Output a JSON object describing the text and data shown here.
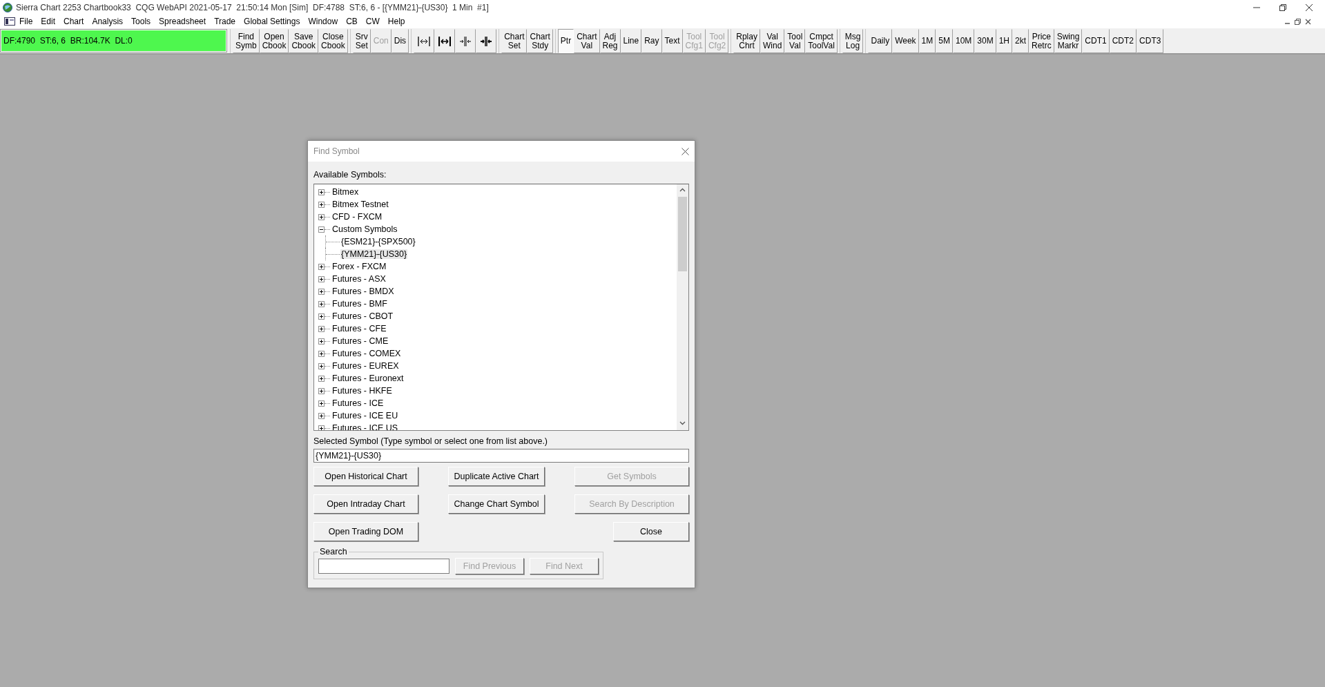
{
  "window": {
    "title": "Sierra Chart 2253 Chartbook33  CQG WebAPI 2021-05-17  21:50:14 Mon [Sim]  DF:4788  ST:6, 6 - [{YMM21}-{US30}  1 Min  #1]"
  },
  "menu": [
    "File",
    "Edit",
    "Chart",
    "Analysis",
    "Tools",
    "Spreadsheet",
    "Trade",
    "Global Settings",
    "Window",
    "CB",
    "CW",
    "Help"
  ],
  "status_box": {
    "text": "DF:4790  ST:6, 6  BR:104.7K  DL:0"
  },
  "toolbar": {
    "groups": [
      [
        {
          "kind": "text",
          "label": "Find\nSymb",
          "disabled": false,
          "selected": false
        },
        {
          "kind": "text",
          "label": "Open\nCbook",
          "disabled": false,
          "selected": false
        },
        {
          "kind": "text",
          "label": "Save\nCbook",
          "disabled": false,
          "selected": false
        },
        {
          "kind": "text",
          "label": "Close\nCbook",
          "disabled": false,
          "selected": false
        }
      ],
      [
        {
          "kind": "text",
          "label": "Srv\nSet",
          "disabled": false,
          "selected": false
        },
        {
          "kind": "text",
          "label": "Con",
          "disabled": true,
          "selected": false
        },
        {
          "kind": "text",
          "label": "Dis",
          "disabled": false,
          "selected": false
        }
      ],
      [
        {
          "kind": "icon",
          "disabled": false,
          "selected": false
        },
        {
          "kind": "icon",
          "disabled": false,
          "selected": false
        },
        {
          "kind": "icon",
          "disabled": false,
          "selected": false
        },
        {
          "kind": "icon",
          "disabled": false,
          "selected": false
        }
      ],
      [
        {
          "kind": "text",
          "label": "Chart\nSet",
          "disabled": false,
          "selected": false
        },
        {
          "kind": "text",
          "label": "Chart\nStdy",
          "disabled": false,
          "selected": false
        }
      ],
      [
        {
          "kind": "text",
          "label": "Ptr",
          "disabled": false,
          "selected": true
        },
        {
          "kind": "text",
          "label": "Chart\nVal",
          "disabled": false,
          "selected": false
        },
        {
          "kind": "text",
          "label": "Adj\nReg",
          "disabled": false,
          "selected": false
        },
        {
          "kind": "text",
          "label": "Line",
          "disabled": false,
          "selected": false
        },
        {
          "kind": "text",
          "label": "Ray",
          "disabled": false,
          "selected": false
        },
        {
          "kind": "text",
          "label": "Text",
          "disabled": false,
          "selected": false
        },
        {
          "kind": "text",
          "label": "Tool\nCfg1",
          "disabled": true,
          "selected": false
        },
        {
          "kind": "text",
          "label": "Tool\nCfg2",
          "disabled": true,
          "selected": false
        }
      ],
      [
        {
          "kind": "text",
          "label": "Rplay\nChrt",
          "disabled": false,
          "selected": false
        },
        {
          "kind": "text",
          "label": "Val\nWind",
          "disabled": false,
          "selected": false
        },
        {
          "kind": "text",
          "label": "Tool\nVal",
          "disabled": false,
          "selected": false
        },
        {
          "kind": "text",
          "label": "Cmpct\nToolVal",
          "disabled": false,
          "selected": false
        }
      ],
      [
        {
          "kind": "text",
          "label": "Msg\nLog",
          "disabled": false,
          "selected": false
        }
      ],
      [
        {
          "kind": "text",
          "label": "Daily",
          "disabled": false,
          "selected": false
        },
        {
          "kind": "text",
          "label": "Week",
          "disabled": false,
          "selected": false
        },
        {
          "kind": "text",
          "label": "1M",
          "disabled": false,
          "selected": false
        },
        {
          "kind": "text",
          "label": "5M",
          "disabled": false,
          "selected": false
        },
        {
          "kind": "text",
          "label": "10M",
          "disabled": false,
          "selected": false
        },
        {
          "kind": "text",
          "label": "30M",
          "disabled": false,
          "selected": false
        },
        {
          "kind": "text",
          "label": "1H",
          "disabled": false,
          "selected": false
        },
        {
          "kind": "text",
          "label": "2kt",
          "disabled": false,
          "selected": false
        },
        {
          "kind": "text",
          "label": "Price\nRetrc",
          "disabled": false,
          "selected": false
        },
        {
          "kind": "text",
          "label": "Swing\nMarkr",
          "disabled": false,
          "selected": false
        },
        {
          "kind": "text",
          "label": "CDT1",
          "disabled": false,
          "selected": false
        },
        {
          "kind": "text",
          "label": "CDT2",
          "disabled": false,
          "selected": false
        },
        {
          "kind": "text",
          "label": "CDT3",
          "disabled": false,
          "selected": false
        }
      ]
    ]
  },
  "dialog": {
    "title": "Find Symbol",
    "list_label": "Available Symbols:",
    "tree": [
      {
        "label": "Bitmex",
        "expanded": false,
        "selected": false
      },
      {
        "label": "Bitmex Testnet",
        "expanded": false,
        "selected": false
      },
      {
        "label": "CFD - FXCM",
        "expanded": false,
        "selected": false
      },
      {
        "label": "Custom Symbols",
        "expanded": true,
        "selected": false,
        "children": [
          {
            "label": "{ESM21}-{SPX500}",
            "selected": false
          },
          {
            "label": "{YMM21}-{US30}",
            "selected": true
          }
        ]
      },
      {
        "label": "Forex - FXCM",
        "expanded": false,
        "selected": false
      },
      {
        "label": "Futures - ASX",
        "expanded": false,
        "selected": false
      },
      {
        "label": "Futures - BMDX",
        "expanded": false,
        "selected": false
      },
      {
        "label": "Futures - BMF",
        "expanded": false,
        "selected": false
      },
      {
        "label": "Futures - CBOT",
        "expanded": false,
        "selected": false
      },
      {
        "label": "Futures - CFE",
        "expanded": false,
        "selected": false
      },
      {
        "label": "Futures - CME",
        "expanded": false,
        "selected": false
      },
      {
        "label": "Futures - COMEX",
        "expanded": false,
        "selected": false
      },
      {
        "label": "Futures - EUREX",
        "expanded": false,
        "selected": false
      },
      {
        "label": "Futures - Euronext",
        "expanded": false,
        "selected": false
      },
      {
        "label": "Futures - HKFE",
        "expanded": false,
        "selected": false
      },
      {
        "label": "Futures - ICE",
        "expanded": false,
        "selected": false
      },
      {
        "label": "Futures - ICE EU",
        "expanded": false,
        "selected": false
      },
      {
        "label": "Futures - ICE US",
        "expanded": false,
        "selected": false
      }
    ],
    "selected_label": "Selected Symbol (Type symbol or select one from list above.)",
    "selected_value": "{YMM21}-{US30}",
    "buttons": [
      {
        "label": "Open Historical Chart",
        "disabled": false
      },
      {
        "label": "Duplicate Active Chart",
        "disabled": false
      },
      {
        "label": "Get Symbols",
        "disabled": true
      },
      {
        "label": "Open Intraday Chart",
        "disabled": false
      },
      {
        "label": "Change Chart Symbol",
        "disabled": false
      },
      {
        "label": "Search By Description",
        "disabled": true
      },
      {
        "label": "Open Trading DOM",
        "disabled": false
      },
      {
        "label": "Close",
        "disabled": false
      }
    ],
    "search": {
      "label": "Search",
      "buttons": [
        {
          "label": "Find Previous",
          "disabled": true
        },
        {
          "label": "Find Next",
          "disabled": true
        }
      ]
    }
  }
}
